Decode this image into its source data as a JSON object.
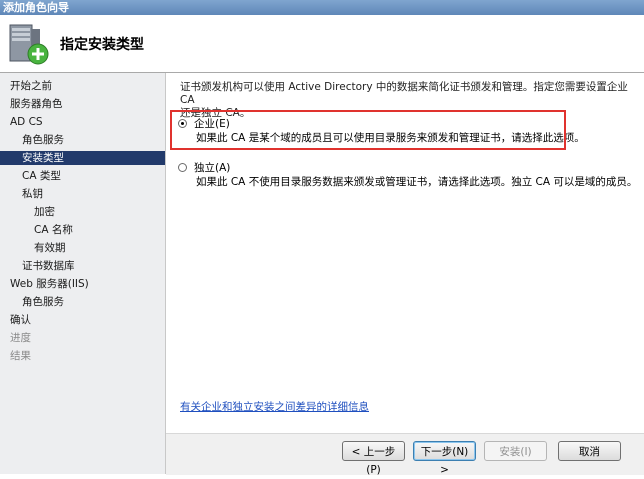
{
  "window": {
    "title": "添加角色向导"
  },
  "header": {
    "title": "指定安装类型",
    "icon": "server-add-icon"
  },
  "sidebar": {
    "items": [
      {
        "label": "开始之前",
        "state": "normal"
      },
      {
        "label": "服务器角色",
        "state": "normal"
      },
      {
        "label": "AD CS",
        "state": "normal"
      },
      {
        "label": "角色服务",
        "state": "normal"
      },
      {
        "label": "安装类型",
        "state": "active"
      },
      {
        "label": "CA 类型",
        "state": "normal"
      },
      {
        "label": "私钥",
        "state": "normal"
      },
      {
        "label": "加密",
        "state": "normal"
      },
      {
        "label": "CA 名称",
        "state": "normal"
      },
      {
        "label": "有效期",
        "state": "normal"
      },
      {
        "label": "证书数据库",
        "state": "normal"
      },
      {
        "label": "Web 服务器(IIS)",
        "state": "normal"
      },
      {
        "label": "角色服务",
        "state": "normal"
      },
      {
        "label": "确认",
        "state": "normal"
      },
      {
        "label": "进度",
        "state": "disabled"
      },
      {
        "label": "结果",
        "state": "disabled"
      }
    ]
  },
  "main": {
    "intro_line1": "证书颁发机构可以使用 Active Directory 中的数据来简化证书颁发和管理。指定您需要设置企业 CA",
    "intro_line2": "还是独立 CA。",
    "options": [
      {
        "label": "企业(E)",
        "description": "如果此 CA 是某个域的成员且可以使用目录服务来颁发和管理证书，请选择此选项。",
        "selected": true
      },
      {
        "label": "独立(A)",
        "description": "如果此 CA 不使用目录服务数据来颁发或管理证书，请选择此选项。独立 CA 可以是域的成员。",
        "selected": false
      }
    ],
    "help_link": "有关企业和独立安装之间差异的详细信息"
  },
  "footer": {
    "prev": "< 上一步(P)",
    "next": "下一步(N) >",
    "install": "安装(I)",
    "cancel": "取消"
  },
  "colors": {
    "active_nav": "#223a6b",
    "highlight": "#e0322e",
    "link": "#1f4fbf"
  }
}
